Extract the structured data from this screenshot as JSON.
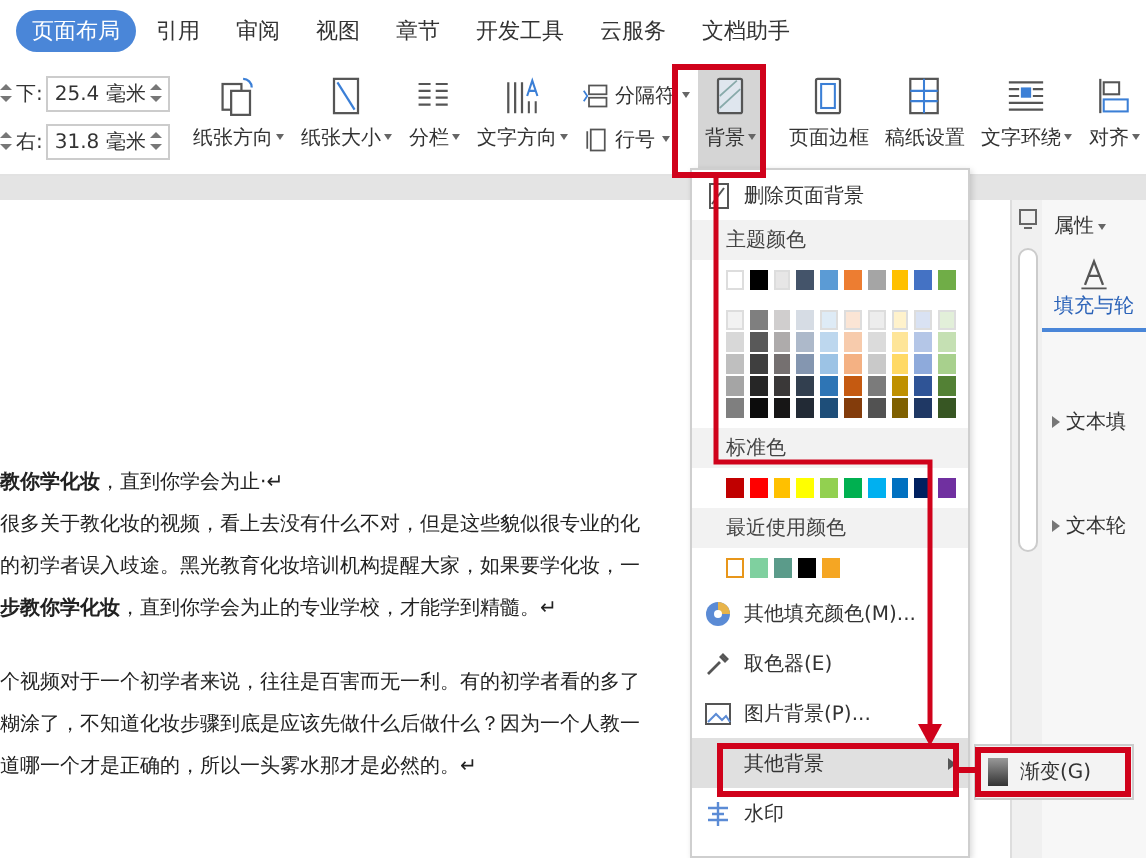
{
  "tabs": [
    {
      "label": "页面布局",
      "selected": true
    },
    {
      "label": "引用",
      "selected": false
    },
    {
      "label": "审阅",
      "selected": false
    },
    {
      "label": "视图",
      "selected": false
    },
    {
      "label": "章节",
      "selected": false
    },
    {
      "label": "开发工具",
      "selected": false
    },
    {
      "label": "云服务",
      "selected": false
    },
    {
      "label": "文档助手",
      "selected": false
    }
  ],
  "ribbon": {
    "margins": [
      {
        "label": "下:",
        "value": "25.4 毫米"
      },
      {
        "label": "右:",
        "value": "31.8 毫米"
      }
    ],
    "buttons": [
      {
        "kind": "large",
        "label": "纸张方向",
        "dropdown": true,
        "pressed": false
      },
      {
        "kind": "large",
        "label": "纸张大小",
        "dropdown": true,
        "pressed": false
      },
      {
        "kind": "large",
        "label": "分栏",
        "dropdown": true,
        "pressed": false
      },
      {
        "kind": "large",
        "label": "文字方向",
        "dropdown": true,
        "pressed": false
      },
      {
        "kind": "stack",
        "items": [
          {
            "label": "分隔符",
            "dropdown": true
          },
          {
            "label": "行号",
            "dropdown": true
          }
        ]
      },
      {
        "kind": "large",
        "label": "背景",
        "dropdown": true,
        "pressed": true
      },
      {
        "kind": "large",
        "label": "页面边框",
        "dropdown": false,
        "pressed": false
      },
      {
        "kind": "large",
        "label": "稿纸设置",
        "dropdown": false,
        "pressed": false
      },
      {
        "kind": "large",
        "label": "文字环绕",
        "dropdown": true,
        "pressed": false
      },
      {
        "kind": "large",
        "label": "对齐",
        "dropdown": true,
        "pressed": false
      }
    ]
  },
  "document": {
    "paragraphs": [
      {
        "lines": [
          "**教你学化妆**，直到你学会为止·↵",
          "很多关于教化妆的视频，看上去没有什么不对，但是这些貌似很专业的化",
          "的初学者误入歧途。黑光教育化妆培训机构提醒大家，如果要学化妆，一",
          "**步教你学化妆**，直到你学会为止的专业学校，才能学到精髓。↵"
        ]
      },
      {
        "lines": [
          "个视频对于一个初学者来说，往往是百害而无一利。有的初学者看的多了",
          "糊涂了，不知道化妆步骤到底是应该先做什么后做什么？因为一个人教一",
          "道哪一个才是正确的，所以一头雾水那才是必然的。↵"
        ]
      }
    ]
  },
  "menu": {
    "items": [
      {
        "kind": "command",
        "label": "删除页面背景",
        "highlighted": false,
        "submenu": false
      },
      {
        "kind": "heading",
        "label": "主题颜色"
      },
      {
        "kind": "swatches",
        "rows": [
          [
            {
              "color": "#ffffff"
            },
            {
              "color": "#000000"
            },
            {
              "color": "#e7e6e6"
            },
            {
              "color": "#44546a"
            },
            {
              "color": "#5b9bd5"
            },
            {
              "color": "#ed7d31"
            },
            {
              "color": "#a5a5a5"
            },
            {
              "color": "#ffc000"
            },
            {
              "color": "#4472c4"
            },
            {
              "color": "#70ad47"
            }
          ]
        ]
      },
      {
        "kind": "swatches",
        "rows": [
          [
            {
              "color": "#f2f2f2"
            },
            {
              "color": "#7f7f7f"
            },
            {
              "color": "#d0cece"
            },
            {
              "color": "#d6dce4"
            },
            {
              "color": "#deebf6"
            },
            {
              "color": "#fbe5d5"
            },
            {
              "color": "#ededed"
            },
            {
              "color": "#fff2cc"
            },
            {
              "color": "#d9e2f3"
            },
            {
              "color": "#e2efd9"
            }
          ],
          [
            {
              "color": "#d8d8d8"
            },
            {
              "color": "#595959"
            },
            {
              "color": "#aeabab"
            },
            {
              "color": "#adb9ca"
            },
            {
              "color": "#bdd7ee"
            },
            {
              "color": "#f7cbac"
            },
            {
              "color": "#dbdbdb"
            },
            {
              "color": "#fee599"
            },
            {
              "color": "#b4c6e7"
            },
            {
              "color": "#c5e0b3"
            }
          ],
          [
            {
              "color": "#bfbfbf"
            },
            {
              "color": "#3f3f3f"
            },
            {
              "color": "#757070"
            },
            {
              "color": "#8496b0"
            },
            {
              "color": "#9cc3e5"
            },
            {
              "color": "#f4b183"
            },
            {
              "color": "#c9c9c9"
            },
            {
              "color": "#ffd965"
            },
            {
              "color": "#8eaadb"
            },
            {
              "color": "#a8d08d"
            }
          ],
          [
            {
              "color": "#a5a5a5"
            },
            {
              "color": "#262626"
            },
            {
              "color": "#3a3838"
            },
            {
              "color": "#323f4f"
            },
            {
              "color": "#2e75b5"
            },
            {
              "color": "#c55a11"
            },
            {
              "color": "#7b7b7b"
            },
            {
              "color": "#bf9000"
            },
            {
              "color": "#2f5496"
            },
            {
              "color": "#538135"
            }
          ],
          [
            {
              "color": "#7f7f7f"
            },
            {
              "color": "#0c0c0c"
            },
            {
              "color": "#171616"
            },
            {
              "color": "#222a35"
            },
            {
              "color": "#1e4e79"
            },
            {
              "color": "#833c0b"
            },
            {
              "color": "#525252"
            },
            {
              "color": "#7f6000"
            },
            {
              "color": "#1f3864"
            },
            {
              "color": "#375623"
            }
          ]
        ]
      },
      {
        "kind": "heading",
        "label": "标准色"
      },
      {
        "kind": "swatches",
        "rows": [
          [
            {
              "color": "#c00000"
            },
            {
              "color": "#ff0000"
            },
            {
              "color": "#ffc000"
            },
            {
              "color": "#ffff00"
            },
            {
              "color": "#92d050"
            },
            {
              "color": "#00b050"
            },
            {
              "color": "#00b0f0"
            },
            {
              "color": "#0070c0"
            },
            {
              "color": "#002060"
            },
            {
              "color": "#7030a0"
            }
          ]
        ]
      },
      {
        "kind": "heading",
        "label": "最近使用颜色"
      },
      {
        "kind": "swatches",
        "rows": [
          [
            {
              "color": "#ffffff",
              "selected": true
            },
            {
              "color": "#7fd09f",
              "selected": false
            },
            {
              "color": "#5b9b8a",
              "selected": false
            },
            {
              "color": "#000000",
              "selected": false
            },
            {
              "color": "#f5a623",
              "selected": false
            }
          ]
        ]
      },
      {
        "kind": "command",
        "label": "其他填充颜色(M)...",
        "highlighted": false,
        "submenu": false
      },
      {
        "kind": "command",
        "label": "取色器(E)",
        "highlighted": false,
        "submenu": false
      },
      {
        "kind": "command",
        "label": "图片背景(P)...",
        "highlighted": false,
        "submenu": false
      },
      {
        "kind": "command",
        "label": "其他背景",
        "highlighted": true,
        "submenu": true
      },
      {
        "kind": "command",
        "label": "水印",
        "highlighted": false,
        "submenu": false
      }
    ]
  },
  "submenu": {
    "items": [
      {
        "label": "渐变(G)"
      }
    ]
  },
  "panel": {
    "title": "属性",
    "tab": "填充与轮",
    "sections": [
      {
        "label": "文本填"
      },
      {
        "label": "文本轮"
      }
    ]
  }
}
